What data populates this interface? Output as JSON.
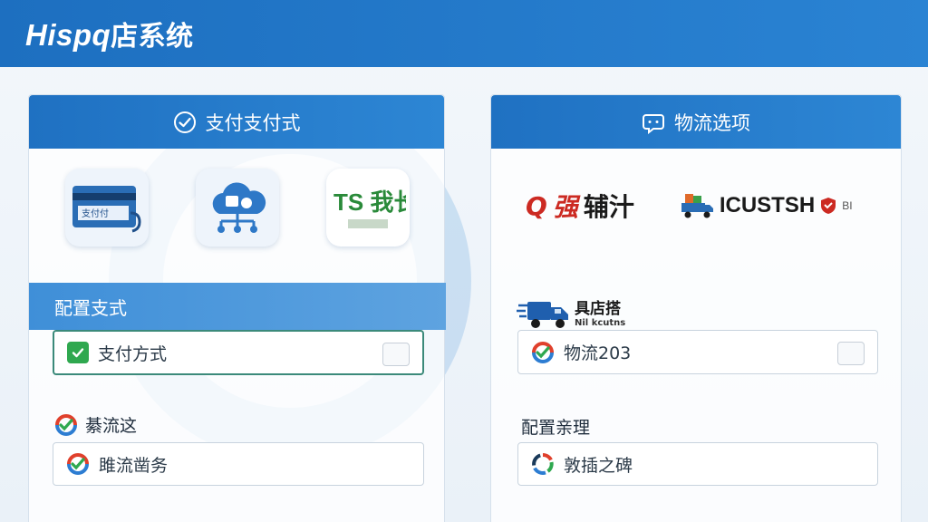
{
  "app": {
    "brand_latin": "Hispq",
    "brand_cn": "店系统"
  },
  "payment_panel": {
    "title": "支付支付式",
    "tiles": [
      {
        "icon": "credit-card-icon",
        "caption": "支付付"
      },
      {
        "icon": "cloud-network-icon"
      },
      {
        "icon": "store-logo-icon",
        "caption": "TS 我长店"
      }
    ],
    "config_section": "配置支式",
    "payment_method_field": {
      "value": "支付方式",
      "checked": true
    },
    "secondary_label": "綦流这",
    "secondary_field": {
      "value": "雎流凿务"
    }
  },
  "logistics_panel": {
    "title": "物流选项",
    "logo_red": {
      "mark": "Q",
      "red_text": "强",
      "dark_text": "辅汁"
    },
    "logo_truck": {
      "text": "ICUSTSH",
      "suffix": "BI"
    },
    "truck_label": {
      "main": "具店搭",
      "sub": "Nil kcutns"
    },
    "logistics_field": {
      "value": "物流203"
    },
    "config_label": "配置亲理",
    "data_field": {
      "value": "敦插之碑"
    }
  },
  "colors": {
    "header_blue": "#1f71c2",
    "check_green": "#2fa84f",
    "active_border": "#3b8a7a"
  }
}
